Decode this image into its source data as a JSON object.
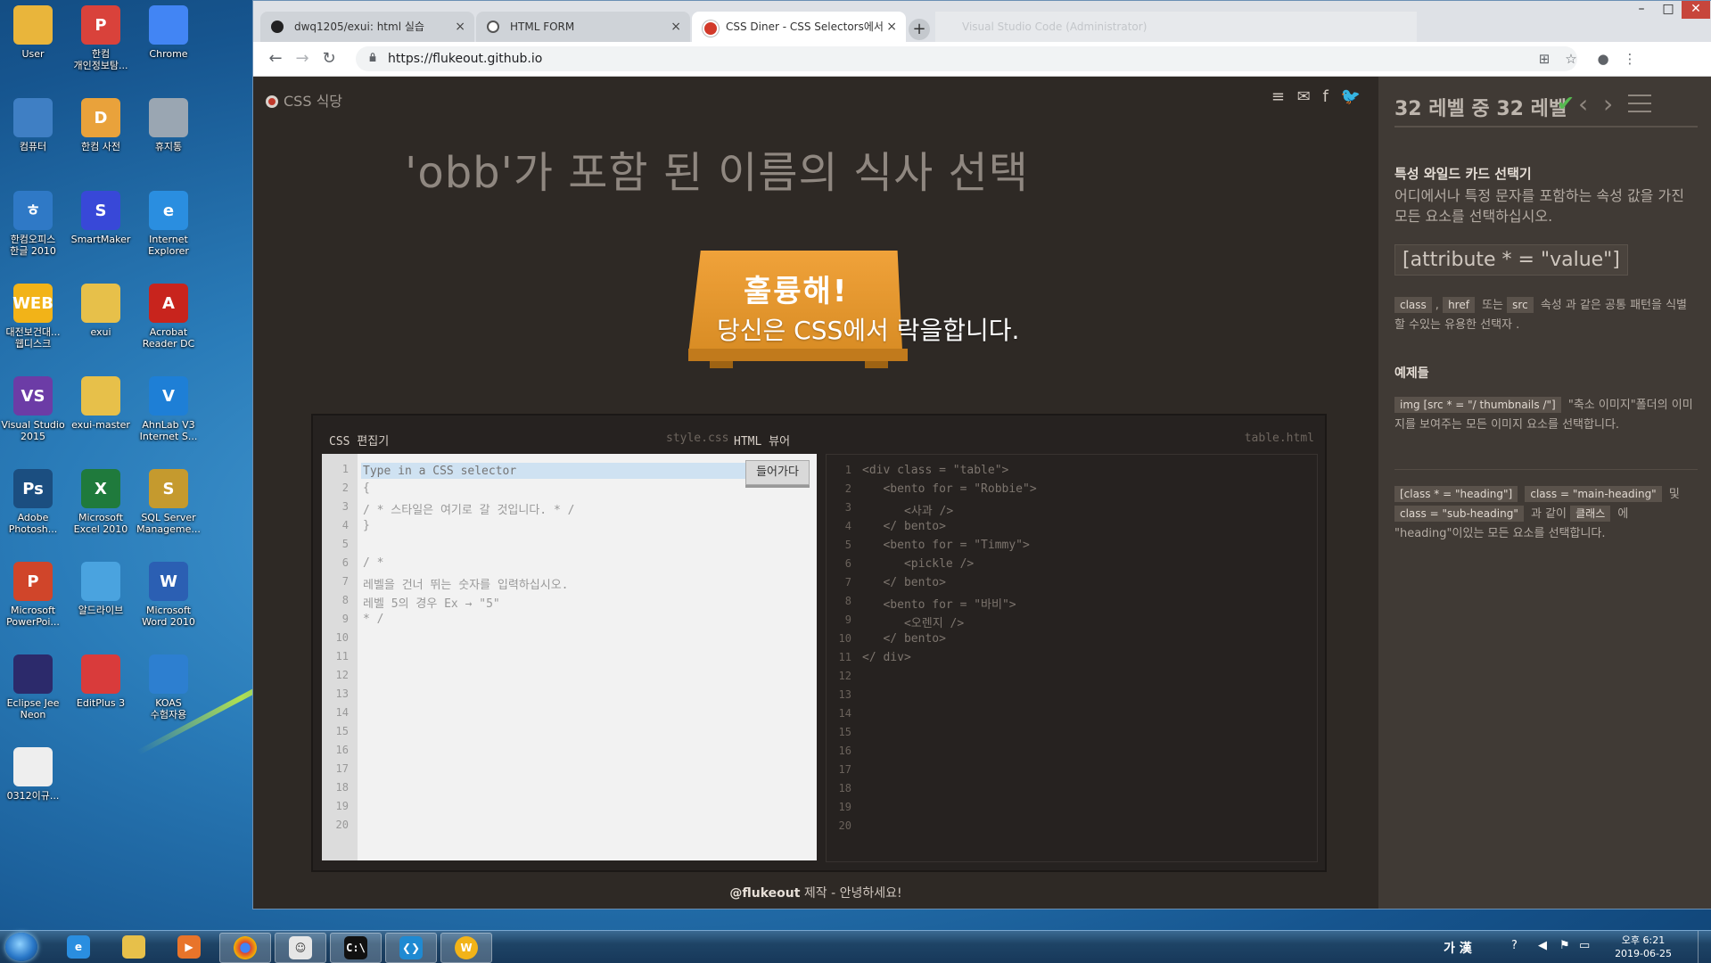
{
  "desktop": {
    "icons": [
      {
        "label": "User",
        "color": "#e9b53b",
        "glyph": ""
      },
      {
        "label": "한컴\n개인정보탐...",
        "color": "#d9423b",
        "glyph": "P"
      },
      {
        "label": "Chrome",
        "color": "#4285f4",
        "glyph": ""
      },
      {
        "label": "컴퓨터",
        "color": "#3f7fc4",
        "glyph": ""
      },
      {
        "label": "한컴 사전",
        "color": "#e9a23b",
        "glyph": "D"
      },
      {
        "label": "휴지통",
        "color": "#9aa6b2",
        "glyph": ""
      },
      {
        "label": "한컴오피스\n한글 2010",
        "color": "#2f79c6",
        "glyph": "ㅎ"
      },
      {
        "label": "SmartMaker",
        "color": "#3848d8",
        "glyph": "S"
      },
      {
        "label": "Internet\nExplorer",
        "color": "#2a8ee0",
        "glyph": "e"
      },
      {
        "label": "대전보건대...\n웹디스크",
        "color": "#f2b318",
        "glyph": "WEB"
      },
      {
        "label": "exui",
        "color": "#e7c04a",
        "glyph": ""
      },
      {
        "label": "Acrobat\nReader DC",
        "color": "#c8241d",
        "glyph": "A"
      },
      {
        "label": "Visual Studio\n2015",
        "color": "#6c3ca6",
        "glyph": "VS"
      },
      {
        "label": "exui-master",
        "color": "#e7c04a",
        "glyph": ""
      },
      {
        "label": "AhnLab V3\nInternet S...",
        "color": "#1e7fd6",
        "glyph": "V"
      },
      {
        "label": "Adobe\nPhotosh...",
        "color": "#1b4e80",
        "glyph": "Ps"
      },
      {
        "label": "Microsoft\nExcel 2010",
        "color": "#1f7a3c",
        "glyph": "X"
      },
      {
        "label": "SQL Server\nManageme...",
        "color": "#c59a2e",
        "glyph": "S"
      },
      {
        "label": "Microsoft\nPowerPoi...",
        "color": "#d0452a",
        "glyph": "P"
      },
      {
        "label": "알드라이브",
        "color": "#4aa3df",
        "glyph": ""
      },
      {
        "label": "Microsoft\nWord 2010",
        "color": "#2b5fb3",
        "glyph": "W"
      },
      {
        "label": "Eclipse Jee\nNeon",
        "color": "#2c2a6b",
        "glyph": ""
      },
      {
        "label": "EditPlus 3",
        "color": "#d93b3b",
        "glyph": ""
      },
      {
        "label": "KOAS\n수험자용",
        "color": "#2d7fd0",
        "glyph": ""
      },
      {
        "label": "0312이규...",
        "color": "#eeeeee",
        "glyph": ""
      }
    ]
  },
  "taskbar": {
    "apps": [
      "ie-icon",
      "explorer-icon",
      "media-player-icon",
      "chrome-icon",
      "hacker-app-icon",
      "cmd-icon",
      "vscode-icon",
      "webhard-icon"
    ],
    "ime": "가 漢",
    "time": "오후 6:21",
    "date": "2019-06-25"
  },
  "browser": {
    "tabs": [
      {
        "title": "dwq1205/exui: html 실습",
        "active": false
      },
      {
        "title": "HTML FORM",
        "active": false
      },
      {
        "title": "CSS Diner - CSS Selectors에서",
        "active": true
      }
    ],
    "ghost_tab": "Visual Studio Code (Administrator)",
    "url": "https://flukeout.github.io"
  },
  "game": {
    "logo": "CSS 식당",
    "order_instruction": "'obb'가 포함 된 이름의 식사 선택",
    "win_title": "훌륭해!",
    "win_subtitle": "당신은 CSS에서 락을합니다.",
    "css_editor_label": "CSS 편집기",
    "css_file": "style.css",
    "html_viewer_label": "HTML 뷰어",
    "html_file": "table.html",
    "input_placeholder": "Type in a CSS selector",
    "enter_button": "들어가다",
    "css_lines": [
      "{",
      "/ * 스타일은 여기로 갈 것입니다. * /",
      "}",
      "",
      "/ *",
      "레벨을 건너 뛰는 숫자를 입력하십시오.",
      "레벨 5의 경우 Ex → \"5\"",
      "* /"
    ],
    "html_lines": [
      "<div class = \"table\">",
      "   <bento for = \"Robbie\">",
      "      <사과 />",
      "   </ bento>",
      "   <bento for = \"Timmy\">",
      "      <pickle />",
      "   </ bento>",
      "   <bento for = \"바비\">",
      "      <오렌지 />",
      "   </ bento>",
      "</ div>"
    ],
    "footer_handle": "@flukeout",
    "footer_text": " 제작 - 안녕하세요!",
    "line_count": 20
  },
  "sidebar": {
    "level": "32 레벨 중 32 레벨",
    "heading": "특성 와일드 카드 선택기",
    "description": "어디에서나 특정 문자를 포함하는 속성 값을 가진 모든 요소를 선택하십시오.",
    "syntax": "[attribute * = \"value\"]",
    "tag_class": "class",
    "tag_href": "href",
    "tag_src": "src",
    "text_or": "또는",
    "text_after_tags": "속성 과 같은 공통 패턴을 식별 할 수있는 유용한 선택자 .",
    "examples_heading": "예제들",
    "ex1_code": "img [src * = \"/ thumbnails /\"]",
    "ex1_text": " \"축소 이미지\"폴더의 이미지를 보여주는 모든 이미지 요소를 선택합니다.",
    "ex2_code1": "[class * = \"heading\"]",
    "ex2_code2": "class = \"main-heading\"",
    "ex2_and": "및",
    "ex2_code3": "class = \"sub-heading\"",
    "ex2_like": "과 같이",
    "ex2_code4": "클래스",
    "ex2_tail1": "에",
    "ex2_tail2": "\"heading\"이있는 모든 요소를 선택합니다."
  }
}
